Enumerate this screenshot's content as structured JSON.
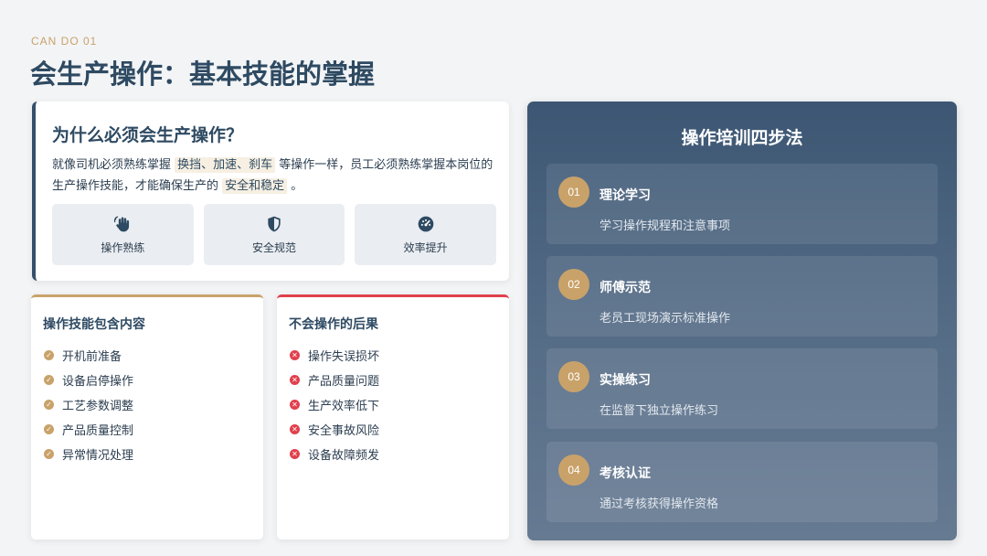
{
  "header": {
    "kicker": "CAN DO 01",
    "title": "会生产操作：基本技能的掌握"
  },
  "why": {
    "title": "为什么必须会生产操作？",
    "text_1": "就像司机必须熟练掌握 ",
    "hl_1": "换挡、加速、刹车",
    "text_2": " 等操作一样，员工必须熟练掌握本岗位的生产操作技能，才能确保生产的 ",
    "hl_2": "安全和稳定",
    "text_3": " 。",
    "skills": [
      {
        "label": "操作熟练",
        "icon": "hand-wave-icon"
      },
      {
        "label": "安全规范",
        "icon": "shield-icon"
      },
      {
        "label": "效率提升",
        "icon": "speedometer-icon"
      }
    ]
  },
  "skills_card": {
    "title": "操作技能包含内容",
    "items": [
      "开机前准备",
      "设备启停操作",
      "工艺参数调整",
      "产品质量控制",
      "异常情况处理"
    ]
  },
  "risks_card": {
    "title": "不会操作的后果",
    "items": [
      "操作失误损坏",
      "产品质量问题",
      "生产效率低下",
      "安全事故风险",
      "设备故障频发"
    ]
  },
  "steps": {
    "title": "操作培训四步法",
    "items": [
      {
        "num": "01",
        "name": "理论学习",
        "desc": "学习操作规程和注意事项"
      },
      {
        "num": "02",
        "name": "师傅示范",
        "desc": "老员工现场演示标准操作"
      },
      {
        "num": "03",
        "name": "实操练习",
        "desc": "在监督下独立操作练习"
      },
      {
        "num": "04",
        "name": "考核认证",
        "desc": "通过考核获得操作资格"
      }
    ]
  },
  "colors": {
    "accent_gold": "#c9a26a",
    "accent_red": "#e0404c",
    "navy": "#2e4a62"
  }
}
